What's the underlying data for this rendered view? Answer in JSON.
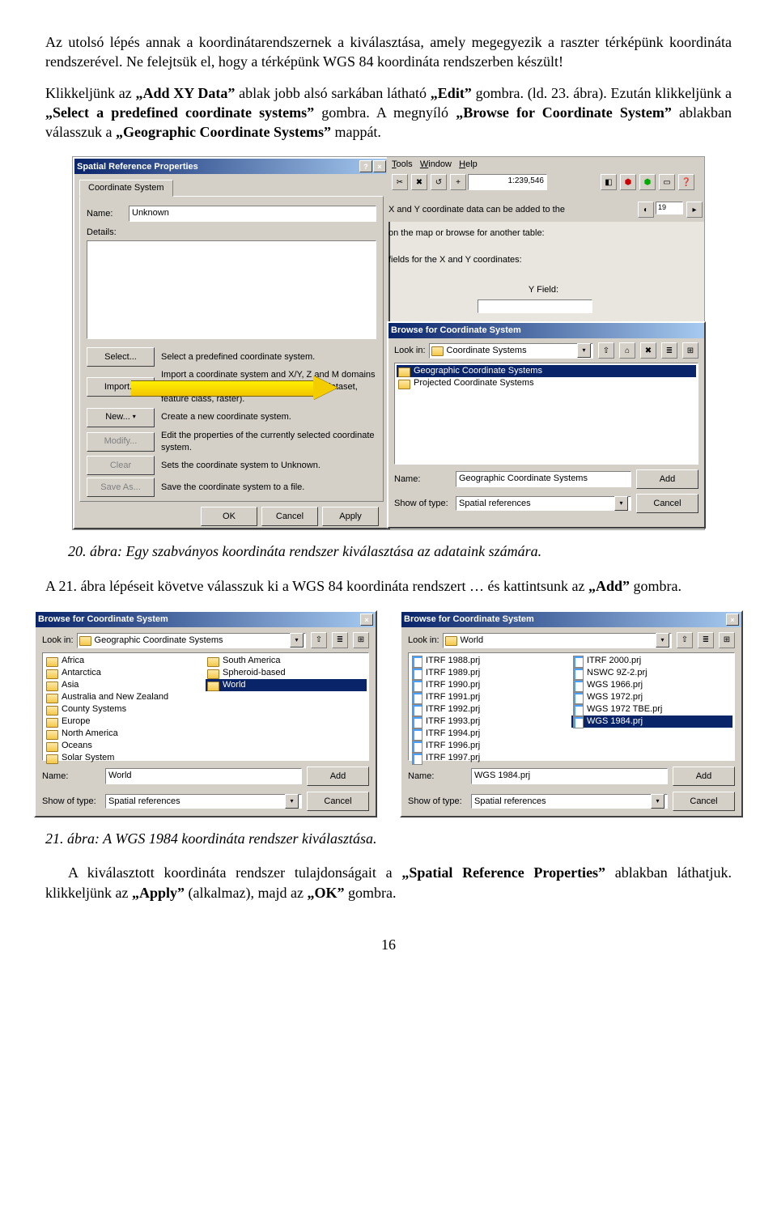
{
  "para1": "Az utolsó lépés annak a koordinátarendszernek a kiválasztása, amely megegyezik a raszter térképünk koordináta rendszerével. Ne felejtsük el, hogy a térképünk WGS 84 koordináta rendszerben készült!",
  "para2_a": "Klikkeljünk az ",
  "para2_b": "„Add XY Data”",
  "para2_c": " ablak jobb alsó sarkában látható ",
  "para2_d": "„Edit”",
  "para2_e": " gombra. (ld. 23. ábra). Ezután klikkeljünk a ",
  "para2_f": "„Select a predefined coordinate systems”",
  "para2_g": " gombra. A megnyíló ",
  "para2_h": "„Browse for Coordinate System”",
  "para2_i": " ablakban válasszuk a ",
  "para2_j": "„Geographic Coordinate Systems”",
  "para2_k": " mappát.",
  "caption20": "20. ábra: Egy szabványos koordináta rendszer kiválasztása az adataink számára.",
  "para3_a": "A 21. ábra lépéseit követve válasszuk ki a WGS 84 koordináta rendszert … és kattintsunk az ",
  "para3_b": "„Add”",
  "para3_c": " gombra.",
  "caption21": "21. ábra: A WGS 1984 koordináta rendszer kiválasztása.",
  "para4_a": "A kiválasztott koordináta rendszer tulajdonságait a ",
  "para4_b": "„Spatial Reference Properties”",
  "para4_c": " ablakban láthatjuk. klikkeljünk az ",
  "para4_d": "„Apply”",
  "para4_e": " (alkalmaz), majd az ",
  "para4_f": "„OK”",
  "para4_g": " gombra.",
  "page": "16",
  "srp": {
    "title": "Spatial Reference Properties",
    "tab": "Coordinate System",
    "name_lbl": "Name:",
    "name_val": "Unknown",
    "details_lbl": "Details:",
    "btns": {
      "select": "Select...",
      "select_d": "Select a predefined coordinate system.",
      "import": "Import...",
      "import_d": "Import a coordinate system and X/Y, Z and M domains from an existing geodataset (e.g., feature dataset, feature class, raster).",
      "new": "New...",
      "new_d": "Create a new coordinate system.",
      "modify": "Modify...",
      "modify_d": "Edit the properties of the currently selected coordinate system.",
      "clear": "Clear",
      "clear_d": "Sets the coordinate system to Unknown.",
      "save": "Save As...",
      "save_d": "Save the coordinate system to a file."
    },
    "ok": "OK",
    "cancel": "Cancel",
    "apply": "Apply"
  },
  "bgapp": {
    "menu": "Tools   Window   Help",
    "scale": "1:239,546",
    "xy_hint1": "X and Y coordinate data can be added to the",
    "xy_hint2": "on the map or browse for another table:",
    "yfield": "Y Field:",
    "fieldsfor": "fields for the X and Y coordinates:"
  },
  "bfcs": {
    "title": "Browse for Coordinate System",
    "lookin": "Look in:",
    "lookin_val": "Coordinate Systems",
    "item1": "Geographic Coordinate Systems",
    "item2": "Projected Coordinate Systems",
    "name_lbl": "Name:",
    "name_val": "Geographic Coordinate Systems",
    "show_lbl": "Show of type:",
    "show_val": "Spatial references",
    "add": "Add",
    "cancel": "Cancel"
  },
  "b21a": {
    "title": "Browse for Coordinate System",
    "lookin_val": "Geographic Coordinate Systems",
    "col1": [
      "Africa",
      "Antarctica",
      "Asia",
      "Australia and New Zealand",
      "County Systems",
      "Europe",
      "North America",
      "Oceans",
      "Solar System"
    ],
    "col2": [
      "South America",
      "Spheroid-based",
      "World"
    ],
    "name_val": "World",
    "show_val": "Spatial references"
  },
  "b21b": {
    "title": "Browse for Coordinate System",
    "lookin_val": "World",
    "col1": [
      "ITRF 1988.prj",
      "ITRF 1989.prj",
      "ITRF 1990.prj",
      "ITRF 1991.prj",
      "ITRF 1992.prj",
      "ITRF 1993.prj",
      "ITRF 1994.prj",
      "ITRF 1996.prj",
      "ITRF 1997.prj"
    ],
    "col2": [
      "ITRF 2000.prj",
      "NSWC 9Z-2.prj",
      "WGS 1966.prj",
      "WGS 1972.prj",
      "WGS 1972 TBE.prj",
      "WGS 1984.prj"
    ],
    "name_val": "WGS 1984.prj",
    "show_val": "Spatial references"
  },
  "common": {
    "lookin": "Look in:",
    "name": "Name:",
    "show": "Show of type:",
    "add": "Add",
    "cancel": "Cancel"
  }
}
